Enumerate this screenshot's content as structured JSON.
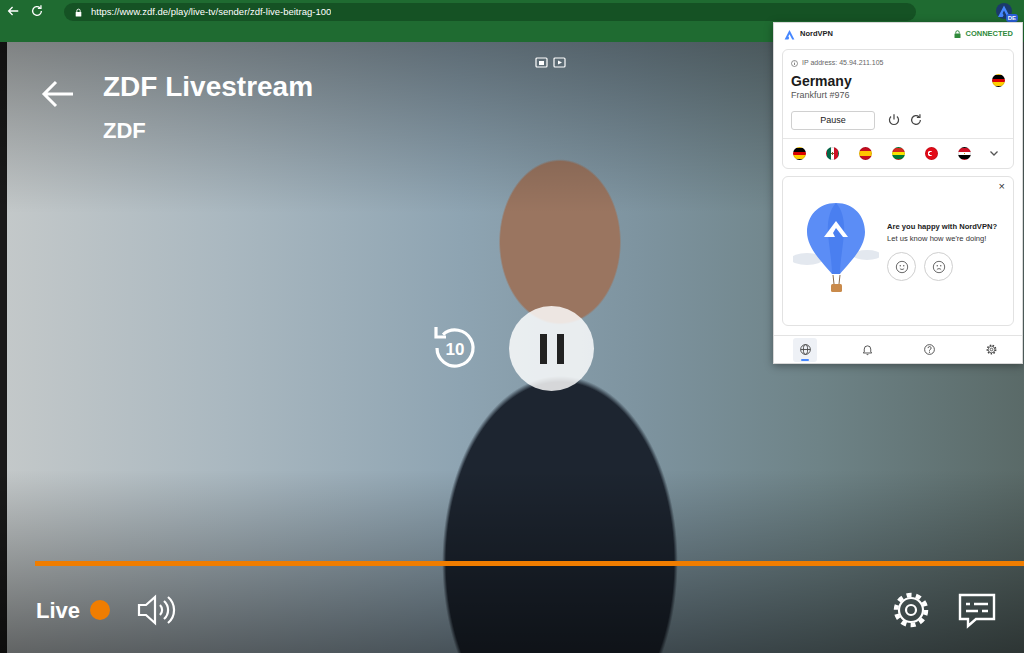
{
  "browser": {
    "url": "https://www.zdf.de/play/live-tv/sender/zdf-live-beitrag-100",
    "extension_badge": "DE"
  },
  "player": {
    "title": "ZDF Livestream",
    "channel": "ZDF",
    "rewind_label": "10",
    "playing": true,
    "progress": {
      "level": 1
    },
    "live_label": "Live"
  },
  "vpn": {
    "brand": "NordVPN",
    "status": "CONNECTED",
    "connected": true,
    "ip_label": "IP address: 45.94.211.105",
    "location": {
      "country": "Germany",
      "server": "Frankfurt #976",
      "kind": "de"
    },
    "pause_label": "Pause",
    "quick_connect": [
      {
        "kind": "de"
      },
      {
        "kind": "mx"
      },
      {
        "kind": "es"
      },
      {
        "kind": "bo"
      },
      {
        "kind": "tr"
      },
      {
        "kind": "eg"
      }
    ],
    "feedback": {
      "title": "Are you happy with NordVPN?",
      "subtitle": "Let us know how we're doing!",
      "close": "×",
      "options": [
        {
          "kind": "happy"
        },
        {
          "kind": "sad"
        }
      ]
    },
    "nav": [
      {
        "kind": "globe",
        "selected": true
      },
      {
        "kind": "bell",
        "selected": false
      },
      {
        "kind": "help",
        "selected": false
      },
      {
        "kind": "settings",
        "selected": false
      }
    ]
  }
}
